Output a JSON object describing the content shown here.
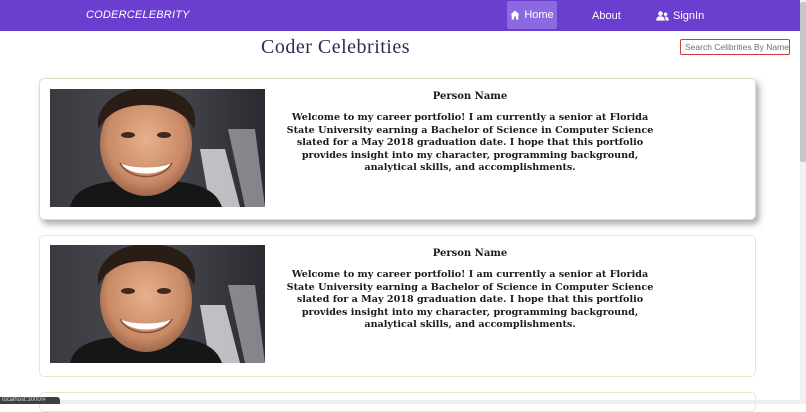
{
  "navbar": {
    "brand": "CODERCELEBRITY",
    "items": [
      {
        "label": "Home",
        "icon": "home-icon"
      },
      {
        "label": "About"
      },
      {
        "label": "SignIn",
        "icon": "users-icon"
      }
    ],
    "colors": {
      "background": "#6a3fcf",
      "active": "#8b69e0"
    }
  },
  "header": {
    "title": "Coder Celebrities",
    "search_placeholder": "Search Celibrities By Name"
  },
  "cards": [
    {
      "name": "Person Name",
      "bio": "Welcome to my career portfolio! I am currently a senior at Florida State University earning a Bachelor of Science in Computer Science slated for a May 2018 graduation date. I hope that this portfolio provides insight into my character, programming background, analytical skills, and accomplishments.",
      "photo": "celebrity-portrait"
    },
    {
      "name": "Person Name",
      "bio": "Welcome to my career portfolio! I am currently a senior at Florida State University earning a Bachelor of Science in Computer Science slated for a May 2018 graduation date. I hope that this portfolio provides insight into my character, programming background, analytical skills, and accomplishments.",
      "photo": "celebrity-portrait"
    }
  ],
  "status_tip": "localhost:3000/#"
}
